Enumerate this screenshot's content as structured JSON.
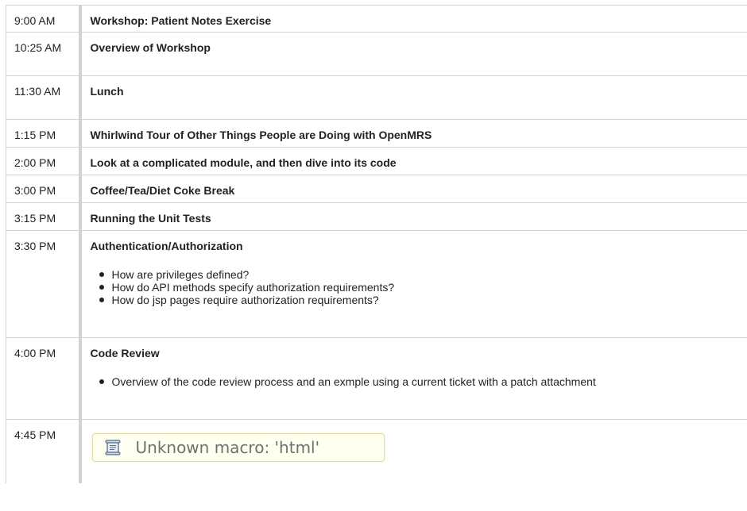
{
  "schedule": {
    "rows": [
      {
        "time": "9:00 AM",
        "title": "Workshop: Patient Notes Exercise"
      },
      {
        "time": "10:25 AM",
        "title": "Overview of Workshop"
      },
      {
        "time": "11:30 AM",
        "title": "Lunch"
      },
      {
        "time": "1:15 PM",
        "title": "Whirlwind Tour of Other Things People are Doing with OpenMRS"
      },
      {
        "time": "2:00 PM",
        "title": "Look at a complicated module, and then dive into its code"
      },
      {
        "time": "3:00 PM",
        "title": "Coffee/Tea/Diet Coke Break"
      },
      {
        "time": "3:15 PM",
        "title": "Running the Unit Tests"
      },
      {
        "time": "3:30 PM",
        "title": "Authentication/Authorization",
        "bullets": [
          "How are privileges defined?",
          "How do API methods specify authorization requirements?",
          "How do jsp pages require authorization requirements?"
        ]
      },
      {
        "time": "4:00 PM",
        "title": "Code Review",
        "bullets": [
          "Overview of the code review process and an exmple using a current ticket with a patch attachment"
        ]
      },
      {
        "time": "4:45 PM",
        "macro": "Unknown macro: 'html'"
      }
    ]
  },
  "macro_icon": "scroll-document-icon",
  "colors": {
    "border": "#d2d2d2",
    "macro_background": "#fffff0",
    "macro_border": "#e8d9a8",
    "macro_text": "#707070"
  }
}
